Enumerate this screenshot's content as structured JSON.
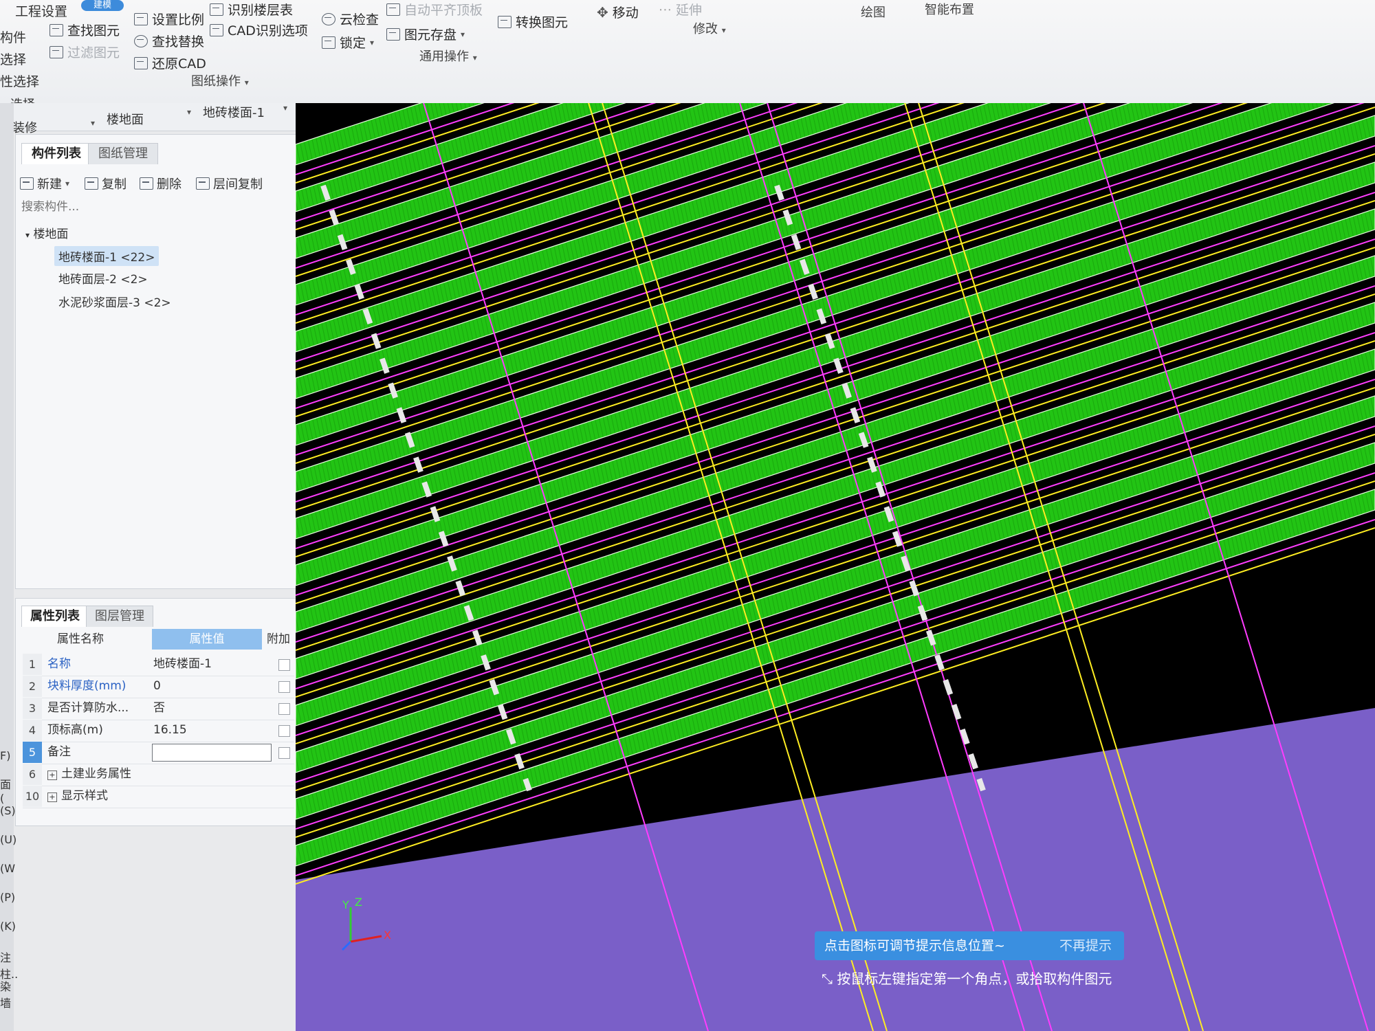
{
  "ribbon": {
    "project_settings": "工程设置",
    "chip": "建模",
    "left_labels": [
      "构件",
      "选择",
      "性选择"
    ],
    "find_element": "查找图元",
    "filter_element": "过滤图元",
    "set_scale": "设置比例",
    "find_replace": "查找替换",
    "restore_cad": "还原CAD",
    "identify_floor_table": "识别楼层表",
    "cad_options": "CAD识别选项",
    "drawing_ops": "图纸操作",
    "cloud_check": "云检查",
    "lock": "锁定",
    "auto_flat_slab": "自动平齐顶板",
    "element_save": "图元存盘",
    "convert_element": "转换图元",
    "general_ops": "通用操作",
    "move": "移动",
    "extend": "延伸",
    "modify": "修改",
    "draw": "绘图",
    "smart_layout": "智能布置",
    "select": "选择"
  },
  "layerbar": {
    "category": "装修",
    "type": "楼地面",
    "element": "地砖楼面-1"
  },
  "left_strip": [
    "F)",
    "面(",
    "(S)",
    "(U)",
    "(W",
    "(P)",
    "(K)",
    "注柱..",
    "染墙"
  ],
  "component_panel": {
    "tabs": [
      "构件列表",
      "图纸管理"
    ],
    "toolbar": {
      "new": "新建",
      "copy": "复制",
      "delete": "删除",
      "floor_copy": "层间复制"
    },
    "search_placeholder": "搜索构件...",
    "tree_root": "楼地面",
    "items": [
      "地砖楼面-1 <22>",
      "地砖面层-2 <2>",
      "水泥砂浆面层-3 <2>"
    ]
  },
  "property_panel": {
    "tabs": [
      "属性列表",
      "图层管理"
    ],
    "col_name": "属性名称",
    "col_value": "属性值",
    "col_extra": "附加",
    "rows": [
      {
        "num": "1",
        "name": "名称",
        "value": "地砖楼面-1"
      },
      {
        "num": "2",
        "name": "块料厚度(mm)",
        "value": "0"
      },
      {
        "num": "3",
        "name": "是否计算防水...",
        "value": "否"
      },
      {
        "num": "4",
        "name": "顶标高(m)",
        "value": "16.15"
      },
      {
        "num": "5",
        "name": "备注",
        "value": ""
      },
      {
        "num": "6",
        "name": "土建业务属性",
        "value": ""
      },
      {
        "num": "10",
        "name": "显示样式",
        "value": ""
      }
    ]
  },
  "viewport": {
    "tip": "点击图标可调节提示信息位置~",
    "tip_dismiss": "不再提示",
    "status": "按鼠标左键指定第一个角点，或拾取构件图元",
    "axis_labels": {
      "x": "X",
      "y": "Y",
      "z": "Z"
    },
    "colors": {
      "ribbon": "#22c414",
      "ribbon_edge": "#e8ffe0",
      "magenta": "#ff3cff",
      "yellow": "#ffee22",
      "floor": "#7a5fc8",
      "background": "#000000"
    }
  }
}
